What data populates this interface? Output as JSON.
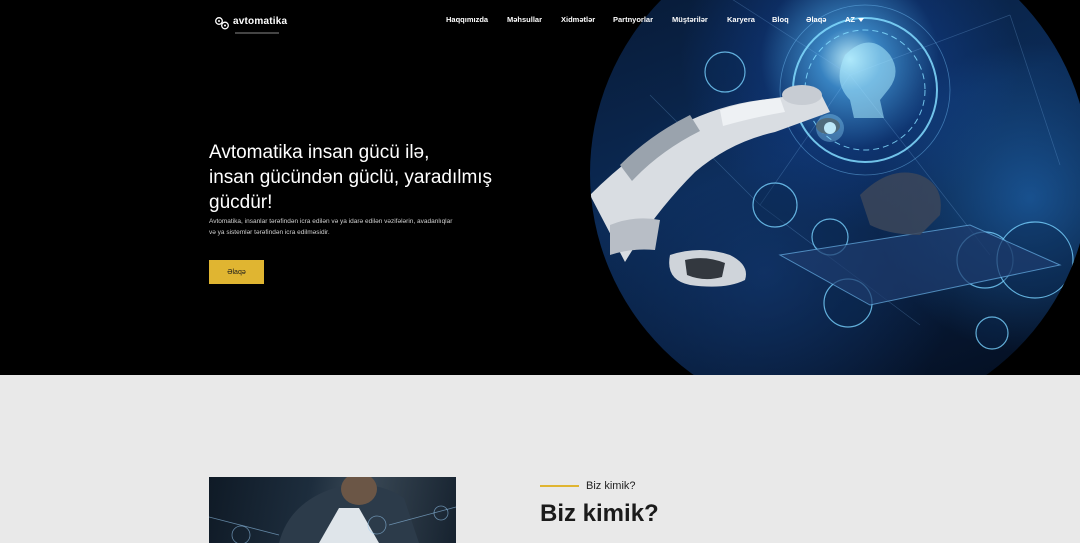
{
  "brand": {
    "logo_text": "avtomatika",
    "logo_icon": "gears-icon"
  },
  "nav": {
    "items": [
      {
        "label": "Haqqımızda"
      },
      {
        "label": "Məhsullar"
      },
      {
        "label": "Xidmətlər"
      },
      {
        "label": "Partnyorlar"
      },
      {
        "label": "Müştərilər"
      },
      {
        "label": "Karyera"
      },
      {
        "label": "Bloq"
      },
      {
        "label": "Əlaqə"
      }
    ],
    "language": "AZ",
    "language_icon": "caret-down-icon"
  },
  "hero": {
    "headline_lines": [
      "Avtomatika insan gücü ilə,",
      "insan gücündən güclü, yaradılmış",
      "gücdür!"
    ],
    "description_line1": "Avtomatika, insanlar tərəfindən icra edilən və ya idarə edilən vəzifələrin, avadanlıqlar",
    "description_line2": "və ya sistemlər tərəfindən icra edilməsidir.",
    "cta_label": "Əlaqə",
    "image_subject": "robot hand touching digital AI interface",
    "colors": {
      "cta_background": "#e0b531",
      "hero_background": "#000000"
    }
  },
  "about": {
    "eyebrow": "Biz kimik?",
    "title": "Biz kimik?",
    "accent_color": "#e0b531",
    "section_background": "#e9e9e9"
  }
}
